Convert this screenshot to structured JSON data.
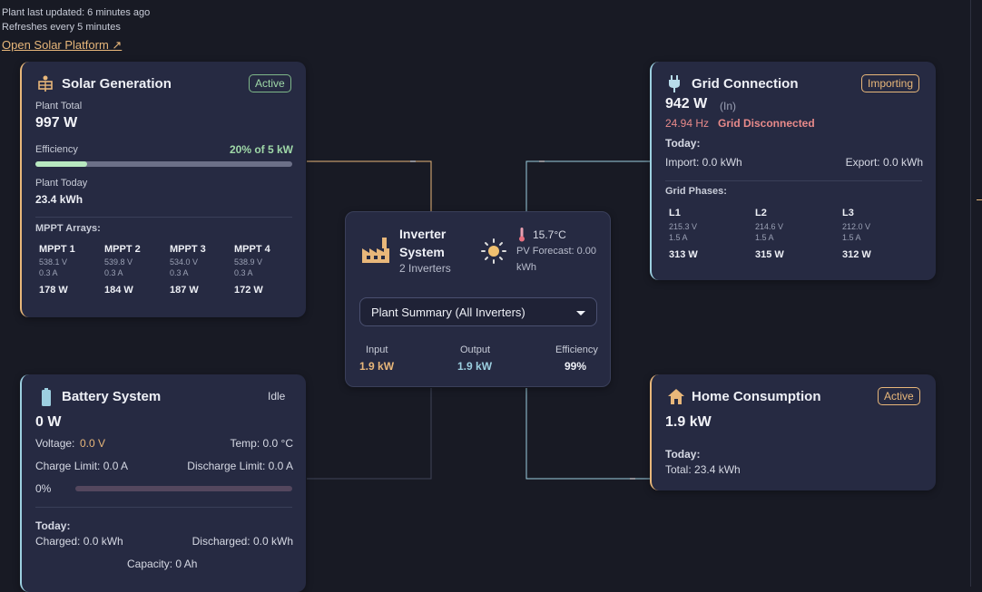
{
  "header": {
    "last_updated": "Plant last updated: 6 minutes ago",
    "refresh": "Refreshes every 5 minutes",
    "link": "Open Solar Platform ↗"
  },
  "colors": {
    "accent": "#e8b77a",
    "cyan": "#9ccfe0",
    "green": "#9fd8a8",
    "error": "#e88a8a",
    "card": "#262a42",
    "bg": "#181a24"
  },
  "solar": {
    "title": "Solar Generation",
    "status": "Active",
    "total_label": "Plant Total",
    "total": "997 W",
    "efficiency_label": "Efficiency",
    "efficiency_value": "20% of 5 kW",
    "efficiency_fraction": 0.2,
    "today_label": "Plant Today",
    "today": "23.4 kWh",
    "arrays_label": "MPPT Arrays:",
    "mppt": [
      {
        "name": "MPPT 1",
        "voltage": "538.1 V",
        "current": "0.3 A",
        "power": "178 W"
      },
      {
        "name": "MPPT 2",
        "voltage": "539.8 V",
        "current": "0.3 A",
        "power": "184 W"
      },
      {
        "name": "MPPT 3",
        "voltage": "534.0 V",
        "current": "0.3 A",
        "power": "187 W"
      },
      {
        "name": "MPPT 4",
        "voltage": "538.9 V",
        "current": "0.3 A",
        "power": "172 W"
      }
    ]
  },
  "grid": {
    "title": "Grid Connection",
    "status": "Importing",
    "power": "942 W",
    "direction": "(In)",
    "frequency": "24.94 Hz",
    "disconnected": "Grid Disconnected",
    "today_label": "Today:",
    "import": "Import: 0.0 kWh",
    "export": "Export: 0.0 kWh",
    "phases_label": "Grid Phases:",
    "phases": [
      {
        "name": "L1",
        "voltage": "215.3 V",
        "current": "1.5 A",
        "power": "313 W"
      },
      {
        "name": "L2",
        "voltage": "214.6 V",
        "current": "1.5 A",
        "power": "315 W"
      },
      {
        "name": "L3",
        "voltage": "212.0 V",
        "current": "1.5 A",
        "power": "312 W"
      }
    ]
  },
  "inverter": {
    "title_line1": "Inverter",
    "title_line2": "System",
    "subtitle": "2 Inverters",
    "temp": "15.7°C",
    "forecast_line1": "PV Forecast: 0.00",
    "forecast_line2": "kWh",
    "select_value": "Plant Summary (All Inverters)",
    "input_label": "Input",
    "input": "1.9 kW",
    "output_label": "Output",
    "output": "1.9 kW",
    "efficiency_label": "Efficiency",
    "efficiency": "99%"
  },
  "battery": {
    "title": "Battery System",
    "status": "Idle",
    "power": "0 W",
    "voltage_label": "Voltage:",
    "voltage": "0.0 V",
    "temp": "Temp: 0.0 °C",
    "charge_limit": "Charge Limit: 0.0 A",
    "discharge_limit": "Discharge Limit: 0.0 A",
    "soc": "0%",
    "soc_fraction": 0,
    "today_label": "Today:",
    "charged": "Charged: 0.0 kWh",
    "discharged": "Discharged: 0.0 kWh",
    "capacity": "Capacity: 0 Ah"
  },
  "home": {
    "title": "Home Consumption",
    "status": "Active",
    "power": "1.9 kW",
    "today_label": "Today:",
    "total": "Total: 23.4 kWh"
  }
}
